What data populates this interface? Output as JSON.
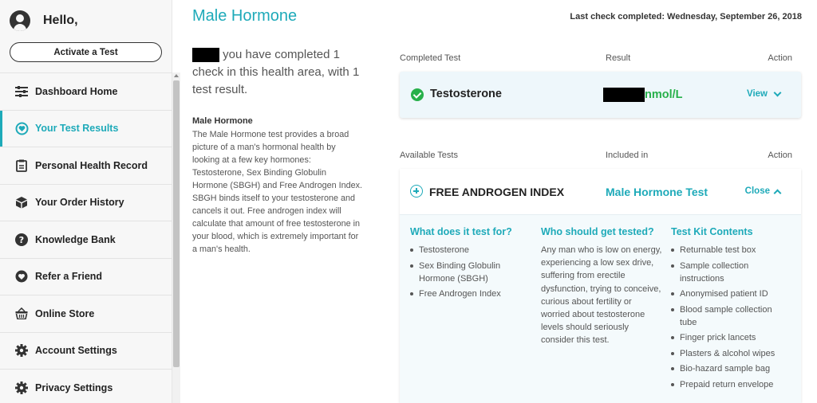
{
  "sidebar": {
    "greeting": "Hello,",
    "activate_label": "Activate a Test",
    "items": [
      {
        "label": "Dashboard Home",
        "icon": "sliders-icon"
      },
      {
        "label": "Your Test Results",
        "icon": "heart-icon"
      },
      {
        "label": "Personal Health Record",
        "icon": "clipboard-icon"
      },
      {
        "label": "Your Order History",
        "icon": "box-icon"
      },
      {
        "label": "Knowledge Bank",
        "icon": "question-icon"
      },
      {
        "label": "Refer a Friend",
        "icon": "heart-outline-icon"
      },
      {
        "label": "Online Store",
        "icon": "basket-icon"
      },
      {
        "label": "Account Settings",
        "icon": "gear-icon"
      },
      {
        "label": "Privacy Settings",
        "icon": "gear-icon"
      }
    ]
  },
  "main": {
    "title": "Male Hormone",
    "last_check": "Last check completed: Wednesday, September 26, 2018",
    "intro": "you have completed 1 check in this health area, with 1 test result.",
    "desc_title": "Male Hormone",
    "desc": "The Male Hormone test provides a broad picture of a man's hormonal health by looking at a few key hormones: Testosterone, Sex Binding Globulin Hormone (SBGH) and Free Androgen Index. SBGH binds itself to your testosterone and cancels it out. Free androgen index will calculate that amount of free testosterone in your blood, which is extremely important for a man's health."
  },
  "completed": {
    "headers": {
      "test": "Completed Test",
      "result": "Result",
      "action": "Action"
    },
    "test_name": "Testosterone",
    "result_unit": "nmol/L",
    "view_label": "View"
  },
  "available": {
    "headers": {
      "test": "Available Tests",
      "included": "Included in",
      "action": "Action"
    },
    "test_name": "FREE ANDROGEN INDEX",
    "included_in": "Male Hormone Test",
    "close_label": "Close",
    "what_title": "What does it test for?",
    "what_items": [
      "Testosterone",
      "Sex Binding Globulin Hormone (SBGH)",
      "Free Androgen Index"
    ],
    "who_title": "Who should get tested?",
    "who_text": "Any man who is low on energy, experiencing a low sex drive, suffering from erectile dysfunction, trying to conceive, curious about fertility or worried about testosterone levels should seriously consider this test.",
    "kit_title": "Test Kit Contents",
    "kit_items": [
      "Returnable test box",
      "Sample collection instructions",
      "Anonymised patient ID",
      "Blood sample collection tube",
      "Finger prick lancets",
      "Plasters & alcohol wipes",
      "Bio-hazard sample bag",
      "Prepaid return envelope"
    ]
  },
  "colors": {
    "accent": "#1eaab9",
    "success": "#27b04a"
  }
}
